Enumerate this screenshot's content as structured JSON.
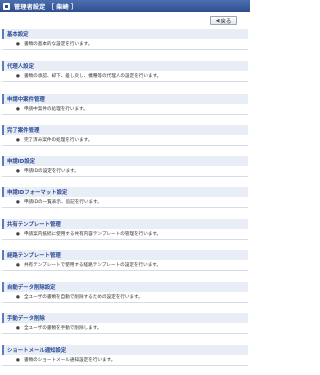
{
  "header": {
    "title": "管理者設定 ［ 柴崎 ］"
  },
  "toolbar": {
    "back_label": "戻る"
  },
  "sections": [
    {
      "title": "基本設定",
      "desc": "書類の基本的な設定を行います。"
    },
    {
      "title": "代理人設定",
      "desc": "書類の承認、却下、差し戻し、機種等の代理人の設定を行います。"
    },
    {
      "title": "申請中案件管理",
      "desc": "申請中案件の処理を行います。"
    },
    {
      "title": "完了案件管理",
      "desc": "完了済み案件の処理を行います。"
    },
    {
      "title": "申請ID設定",
      "desc": "申請IDの設定を行います。"
    },
    {
      "title": "申請IDフォーマット設定",
      "desc": "申請IDの一覧表示、追記を行います。"
    },
    {
      "title": "共有テンプレート管理",
      "desc": "申請案内抵続に使用する共有内容テンプレートの管理を行います。"
    },
    {
      "title": "経路テンプレート管理",
      "desc": "共有テンプレートで使用する経路テンプレートの設定を行います。"
    },
    {
      "title": "自動データ削除設定",
      "desc": "全ユーザの書類を自動で削除するための設定を行います。"
    },
    {
      "title": "手動データ削除",
      "desc": "全ユーザの書類を手動で削除します。"
    },
    {
      "title": "ショートメール通知設定",
      "desc": "書類のショートメール通知設定を行います。"
    }
  ]
}
